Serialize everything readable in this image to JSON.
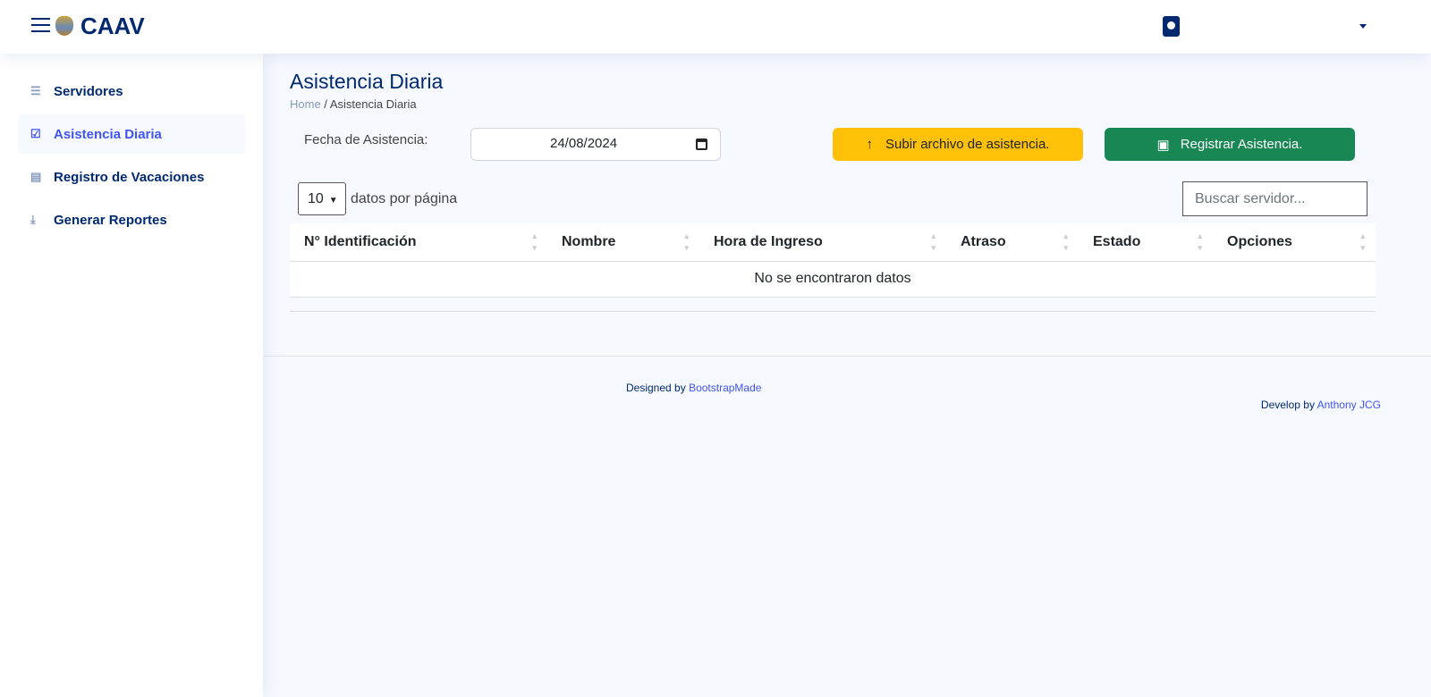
{
  "header": {
    "brand": "CAAV"
  },
  "sidebar": {
    "items": [
      {
        "label": "Servidores",
        "icon": "person-lines-icon"
      },
      {
        "label": "Asistencia Diaria",
        "icon": "checklist-icon"
      },
      {
        "label": "Registro de Vacaciones",
        "icon": "journal-icon"
      },
      {
        "label": "Generar Reportes",
        "icon": "file-download-icon"
      }
    ]
  },
  "main": {
    "title": "Asistencia Diaria",
    "breadcrumb": [
      "Home",
      "Asistencia Diaria"
    ],
    "date_label": "Fecha de Asistencia:",
    "date_value": "24/08/2024",
    "upload_label": "Subir archivo de asistencia.",
    "register_label": "Registrar Asistencia.",
    "per_page": "10",
    "per_page_label": "datos por página",
    "search_placeholder": "Buscar servidor...",
    "columns": [
      "N° Identificación",
      "Nombre",
      "Hora de Ingreso",
      "Atraso",
      "Estado",
      "Opciones"
    ],
    "empty": "No se encontraron datos"
  },
  "footer": {
    "designed_by": "Designed by",
    "designed_link": "BootstrapMade",
    "develop_by": "Develop by",
    "develop_link": "Anthony JCG"
  }
}
